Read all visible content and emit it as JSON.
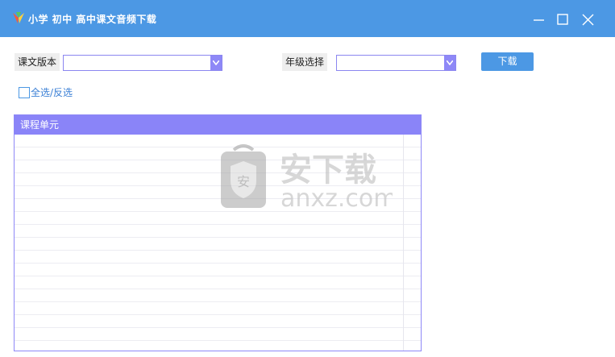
{
  "window": {
    "title": "小学 初中 高中课文音频下载",
    "app_icon": "app-logo-icon",
    "controls": [
      "minimize-icon",
      "maximize-icon",
      "close-icon"
    ]
  },
  "form": {
    "edition_label": "课文版本",
    "edition_value": "",
    "grade_label": "年级选择",
    "grade_value": "",
    "download_label": "下载",
    "select_all_label": "全选/反选",
    "select_all_checked": false
  },
  "grid": {
    "column_header": "课程单元",
    "rows": []
  },
  "watermark": {
    "brand": "安下载",
    "domain": "anxz.com",
    "icon": "shield-bag-icon"
  },
  "colors": {
    "titlebar": "#4c98e4",
    "accent": "#8a84f8",
    "button": "#4c98e4"
  }
}
